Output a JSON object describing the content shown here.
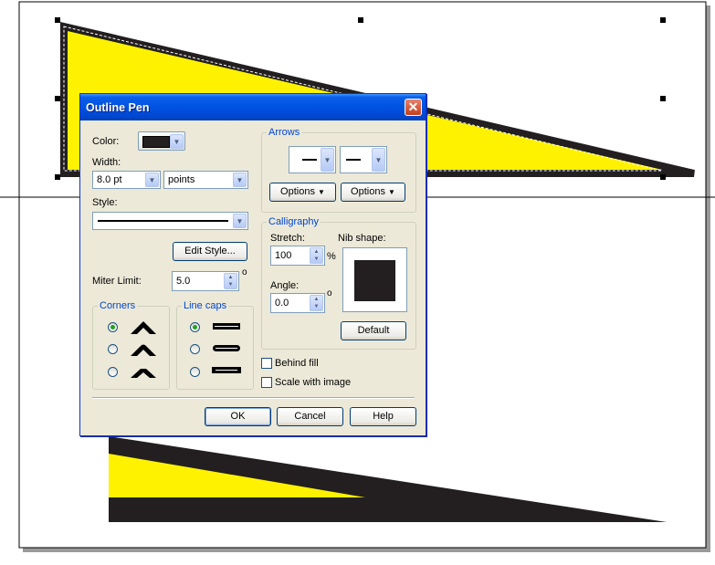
{
  "dialog": {
    "title": "Outline Pen",
    "color_label": "Color:",
    "pen_color": "#231f20",
    "width_label": "Width:",
    "width_value": "8.0 pt",
    "width_units": "points",
    "style_label": "Style:",
    "edit_style_label": "Edit Style...",
    "miter_label": "Miter Limit:",
    "miter_value": "5.0",
    "degree_symbol": "o",
    "corners_title": "Corners",
    "corners_selected": 0,
    "linecaps_title": "Line caps",
    "linecaps_selected": 0,
    "arrows_title": "Arrows",
    "options_label": "Options",
    "calligraphy_title": "Calligraphy",
    "stretch_label": "Stretch:",
    "stretch_value": "100",
    "percent_symbol": "%",
    "nib_label": "Nib shape:",
    "angle_label": "Angle:",
    "angle_value": "0.0",
    "default_label": "Default",
    "behind_fill_label": "Behind fill",
    "scale_label": "Scale with image",
    "ok_label": "OK",
    "cancel_label": "Cancel",
    "help_label": "Help"
  },
  "colors": {
    "fill_yellow": "#fff200",
    "outline_black": "#231f20",
    "titlebar_blue": "#0054e3",
    "dialog_bg": "#ece9d8"
  }
}
